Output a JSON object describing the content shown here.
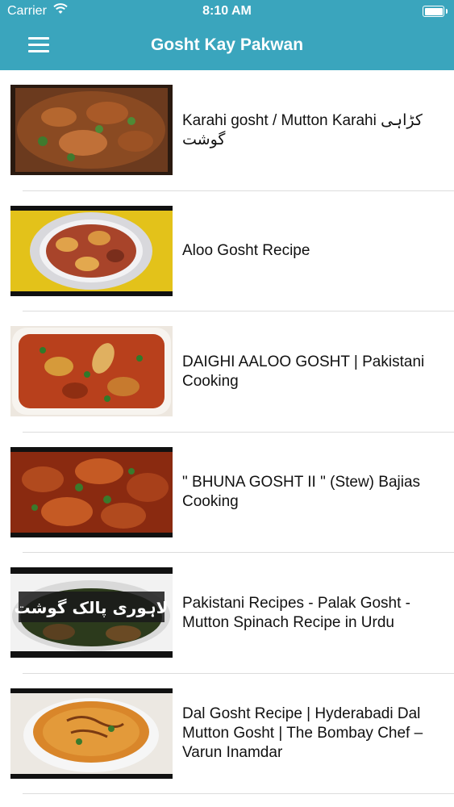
{
  "status_bar": {
    "carrier": "Carrier",
    "time": "8:10 AM"
  },
  "nav": {
    "title": "Gosht Kay Pakwan",
    "menu_icon": "hamburger-menu-icon",
    "bar_color": "#3aa5bd"
  },
  "recipes": [
    {
      "title": "Karahi gosht / Mutton Karahi کڑاہی گوشت",
      "thumb_icon": "karahi-gosht-photo"
    },
    {
      "title": "Aloo Gosht Recipe",
      "thumb_icon": "aloo-gosht-photo"
    },
    {
      "title": "DAIGHI AALOO GOSHT | Pakistani Cooking",
      "thumb_icon": "daighi-aaloo-gosht-photo"
    },
    {
      "title": "\" BHUNA GOSHT II \" (Stew) Bajias Cooking",
      "thumb_icon": "bhuna-gosht-photo"
    },
    {
      "title": "Pakistani Recipes - Palak Gosht - Mutton Spinach Recipe in Urdu",
      "thumb_icon": "palak-gosht-photo",
      "thumb_text": "لاہوری پالک گوشت"
    },
    {
      "title": "Dal Gosht Recipe | Hyderabadi  Dal Mutton Gosht | The Bombay Chef – Varun Inamdar",
      "thumb_icon": "dal-gosht-photo"
    }
  ]
}
